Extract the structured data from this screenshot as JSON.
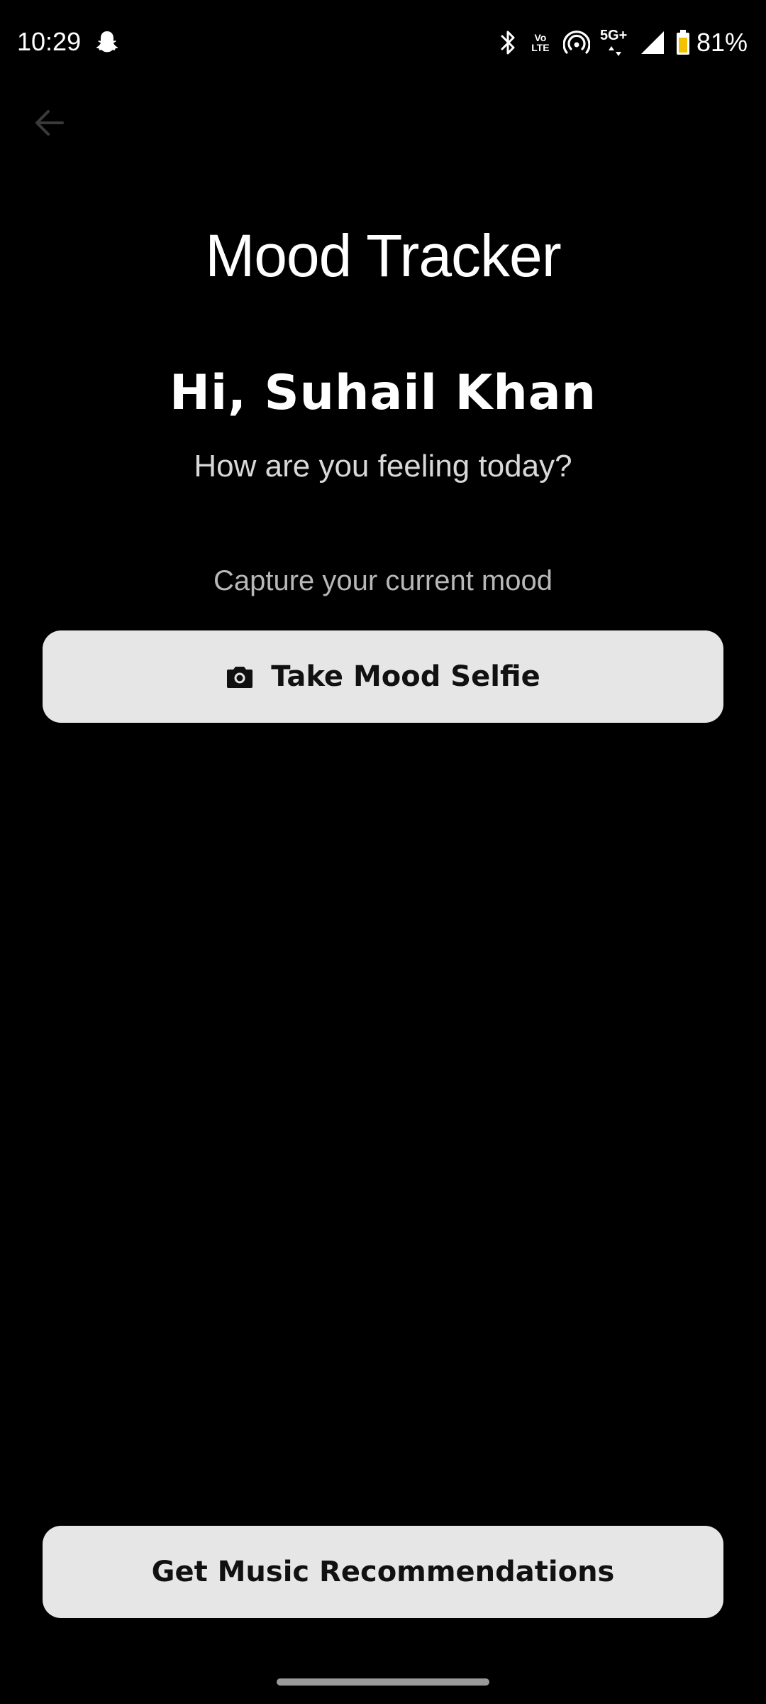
{
  "status_bar": {
    "time": "10:29",
    "battery_percent": "81%",
    "icons": [
      "snapchat-icon",
      "bluetooth-icon",
      "volte-icon",
      "hotspot-icon",
      "5g-plus-icon",
      "cell-signal-icon",
      "battery-icon"
    ],
    "volte_line1": "Vo",
    "volte_line2": "LTE",
    "network_label": "5G+"
  },
  "header": {
    "back_icon": "arrow-left-icon",
    "title": "Mood Tracker"
  },
  "main": {
    "greeting": "Hi, Suhail Khan",
    "subtitle": "How are you feeling today?",
    "capture_label": "Capture your current mood",
    "selfie_button": {
      "icon": "camera-icon",
      "label": "Take Mood Selfie"
    },
    "music_button": {
      "label": "Get Music Recommendations"
    }
  },
  "colors": {
    "background": "#000000",
    "button_background": "#e6e6e6",
    "button_text": "#111111",
    "battery_fill": "#f2c200"
  }
}
